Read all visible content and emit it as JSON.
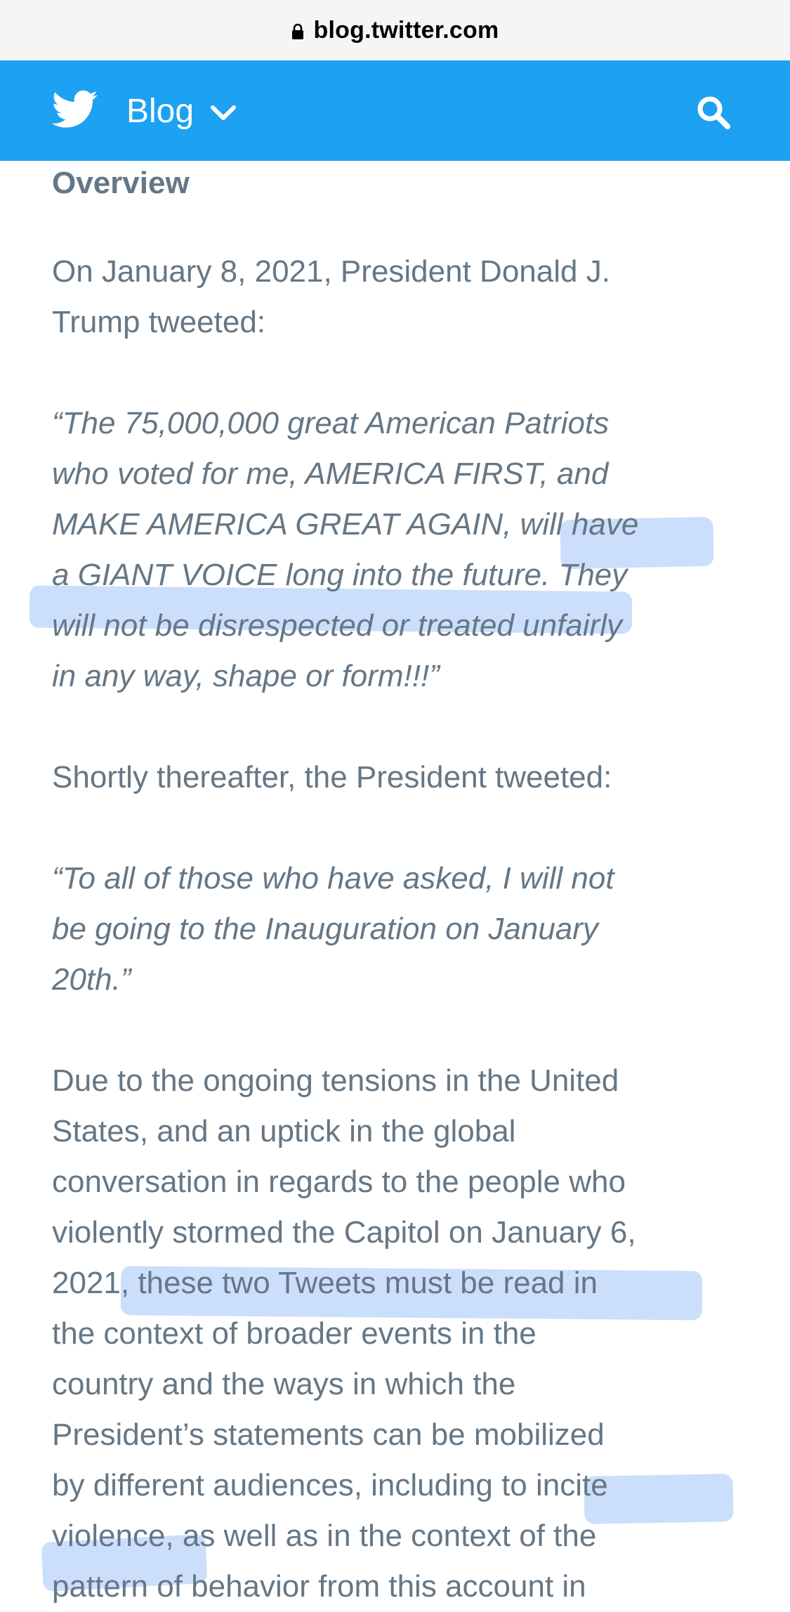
{
  "browser": {
    "url": "blog.twitter.com",
    "lock_icon": "lock-icon"
  },
  "header": {
    "logo_icon": "twitter-bird-icon",
    "menu_label": "Blog",
    "menu_icon": "chevron-down-icon",
    "search_icon": "search-icon",
    "bg_color": "#1da1f2"
  },
  "article": {
    "heading": "Overview",
    "paragraphs": [
      {
        "style": "plain",
        "text": "On January 8, 2021, President Donald J.\nTrump tweeted:"
      },
      {
        "style": "quote",
        "text": "“The 75,000,000 great American Patriots\nwho voted for me, AMERICA FIRST, and\nMAKE AMERICA GREAT AGAIN, will have\na GIANT VOICE long into the future. They\nwill not be disrespected or treated unfairly\nin any way, shape or form!!!”"
      },
      {
        "style": "plain",
        "text": "Shortly thereafter, the President tweeted:"
      },
      {
        "style": "quote",
        "text": "“To all of those who have asked, I will not\nbe going to the Inauguration on January\n20th.”"
      },
      {
        "style": "plain",
        "text": "Due to the ongoing tensions in the United\nStates, and an uptick in the global\nconversation in regards to the people who\nviolently stormed the Capitol on January 6,\n2021, these two Tweets must be read in\nthe context of broader events in the\ncountry and the ways in which the\nPresident’s statements can be mobilized\nby different audiences, including to incite\nviolence, as well as in the context of the\npattern of behavior from this account in"
      }
    ]
  },
  "colors": {
    "text": "#657786",
    "highlight": "#82b0f6"
  }
}
